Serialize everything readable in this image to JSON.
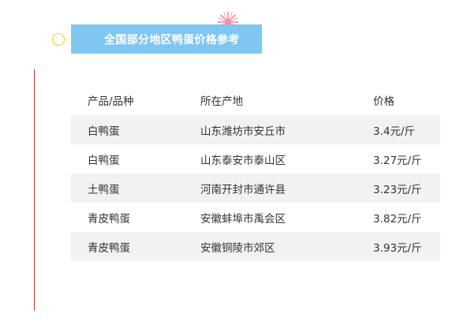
{
  "title": "全国部分地区鸭蛋价格参考",
  "colors": {
    "banner": "#7fc6f3",
    "accent_rule": "#b23a3a",
    "circle": "#f5c518",
    "stripe": "#f2f2f2"
  },
  "table": {
    "headers": [
      "产品/品种",
      "所在产地",
      "价格"
    ],
    "rows": [
      [
        "白鸭蛋",
        "山东潍坊市安丘市",
        "3.4元/斤"
      ],
      [
        "白鸭蛋",
        "山东泰安市泰山区",
        "3.27元/斤"
      ],
      [
        "土鸭蛋",
        "河南开封市通许县",
        "3.23元/斤"
      ],
      [
        "青皮鸭蛋",
        "安徽蚌埠市禹会区",
        "3.82元/斤"
      ],
      [
        "青皮鸭蛋",
        "安徽铜陵市郊区",
        "3.93元/斤"
      ]
    ]
  }
}
